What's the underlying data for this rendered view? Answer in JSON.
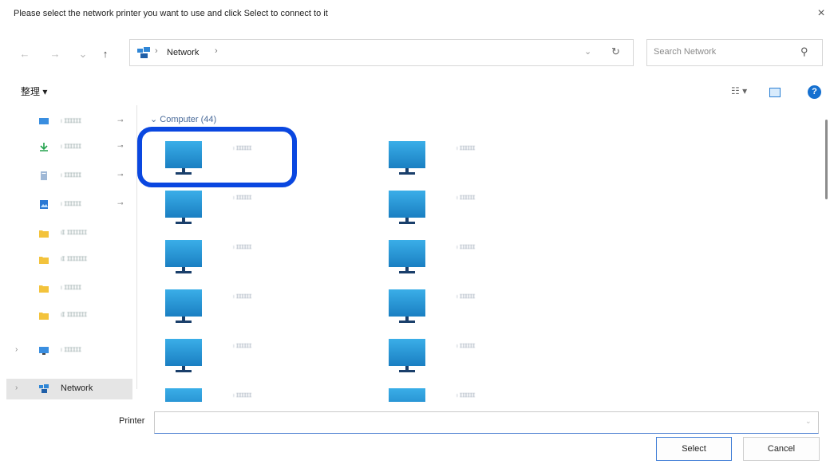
{
  "dialog": {
    "title": "Please select the network printer you want to use and click Select to connect to it",
    "close_glyph": "×"
  },
  "nav_buttons": {
    "back": "←",
    "forward": "→",
    "recent": "⌄",
    "up": "↑"
  },
  "address_bar": {
    "icon": "network-icon",
    "separator": "›",
    "location": "Network",
    "dropdown_glyph": "⌄",
    "refresh_glyph": "↻"
  },
  "search": {
    "placeholder": "Search Network",
    "value": "",
    "icon": "search-icon",
    "glyph": "⚲"
  },
  "toolbar": {
    "organize_label": "整理 ▾",
    "view_options_label": "☷ ▾",
    "help_glyph": "?"
  },
  "sidebar": {
    "items": [
      {
        "label": "ₗ ɪɪɪɪɪɪ",
        "icon": "desktop-icon",
        "pinned": true
      },
      {
        "label": "ₗ ɪɪɪɪɪɪ",
        "icon": "download-icon",
        "pinned": true
      },
      {
        "label": "ₗ ɪɪɪɪɪɪ",
        "icon": "document-icon",
        "pinned": true
      },
      {
        "label": "ₗ ɪɪɪɪɪɪ",
        "icon": "pictures-icon",
        "pinned": true
      },
      {
        "label": "ₗɪ ɪɪɪɪɪɪɪ",
        "icon": "folder-icon",
        "pinned": false
      },
      {
        "label": "ₗɪ ɪɪɪɪɪɪɪ",
        "icon": "folder-icon",
        "pinned": false
      },
      {
        "label": "ₗ ɪɪɪɪɪɪ",
        "icon": "folder-icon",
        "pinned": false
      },
      {
        "label": "ₗɪ ɪɪɪɪɪɪɪ",
        "icon": "folder-icon",
        "pinned": false
      },
      {
        "label": "ₗ ɪɪɪɪɪɪ",
        "icon": "this-pc-icon",
        "pinned": false,
        "expandable": true
      },
      {
        "label": "Network",
        "icon": "network-icon",
        "pinned": false,
        "expandable": true,
        "selected": true
      }
    ],
    "pin_glyph": "⊸",
    "expand_glyph": "›"
  },
  "content": {
    "group_header": "⌄ Computer (44)",
    "tile_label": "ₗ ɪɪɪɪɪɪ",
    "tile_count": 12,
    "monitor_colors": {
      "screen_top": "#3aaee8",
      "screen_bottom": "#1a7fc2",
      "stand": "#1a3f6b"
    }
  },
  "highlight_color": "#0a47e0",
  "footer": {
    "printer_label": "Printer",
    "printer_value": "",
    "dropdown_glyph": "⌄",
    "select_label": "Select",
    "cancel_label": "Cancel"
  }
}
